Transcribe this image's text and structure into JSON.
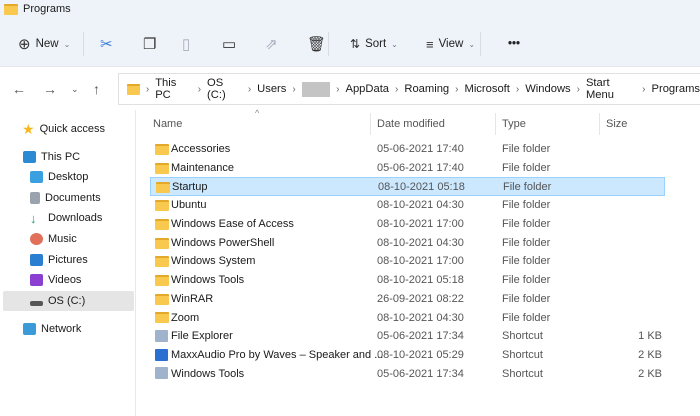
{
  "window": {
    "title": "Programs"
  },
  "toolbar": {
    "new": "New",
    "sort": "Sort",
    "view": "View",
    "more": "•••"
  },
  "breadcrumb": [
    "This PC",
    "OS (C:)",
    "Users",
    "AppData",
    "Roaming",
    "Microsoft",
    "Windows",
    "Start Menu",
    "Programs"
  ],
  "sidebar": {
    "items": [
      "Quick access",
      "This PC",
      "Desktop",
      "Documents",
      "Downloads",
      "Music",
      "Pictures",
      "Videos",
      "OS (C:)",
      "Network"
    ]
  },
  "columns": {
    "name": "Name",
    "date": "Date modified",
    "type": "Type",
    "size": "Size"
  },
  "files": [
    {
      "name": "Accessories",
      "date": "05-06-2021 17:40",
      "type": "File folder",
      "size": ""
    },
    {
      "name": "Maintenance",
      "date": "05-06-2021 17:40",
      "type": "File folder",
      "size": ""
    },
    {
      "name": "Startup",
      "date": "08-10-2021 05:18",
      "type": "File folder",
      "size": ""
    },
    {
      "name": "Ubuntu",
      "date": "08-10-2021 04:30",
      "type": "File folder",
      "size": ""
    },
    {
      "name": "Windows Ease of Access",
      "date": "08-10-2021 17:00",
      "type": "File folder",
      "size": ""
    },
    {
      "name": "Windows PowerShell",
      "date": "08-10-2021 04:30",
      "type": "File folder",
      "size": ""
    },
    {
      "name": "Windows System",
      "date": "08-10-2021 17:00",
      "type": "File folder",
      "size": ""
    },
    {
      "name": "Windows Tools",
      "date": "08-10-2021 05:18",
      "type": "File folder",
      "size": ""
    },
    {
      "name": "WinRAR",
      "date": "26-09-2021 08:22",
      "type": "File folder",
      "size": ""
    },
    {
      "name": "Zoom",
      "date": "08-10-2021 04:30",
      "type": "File folder",
      "size": ""
    },
    {
      "name": "File Explorer",
      "date": "05-06-2021 17:34",
      "type": "Shortcut",
      "size": "1 KB"
    },
    {
      "name": "MaxxAudio Pro by Waves – Speaker and ...",
      "date": "08-10-2021 05:29",
      "type": "Shortcut",
      "size": "2 KB"
    },
    {
      "name": "Windows Tools",
      "date": "05-06-2021 17:34",
      "type": "Shortcut",
      "size": "2 KB"
    }
  ]
}
